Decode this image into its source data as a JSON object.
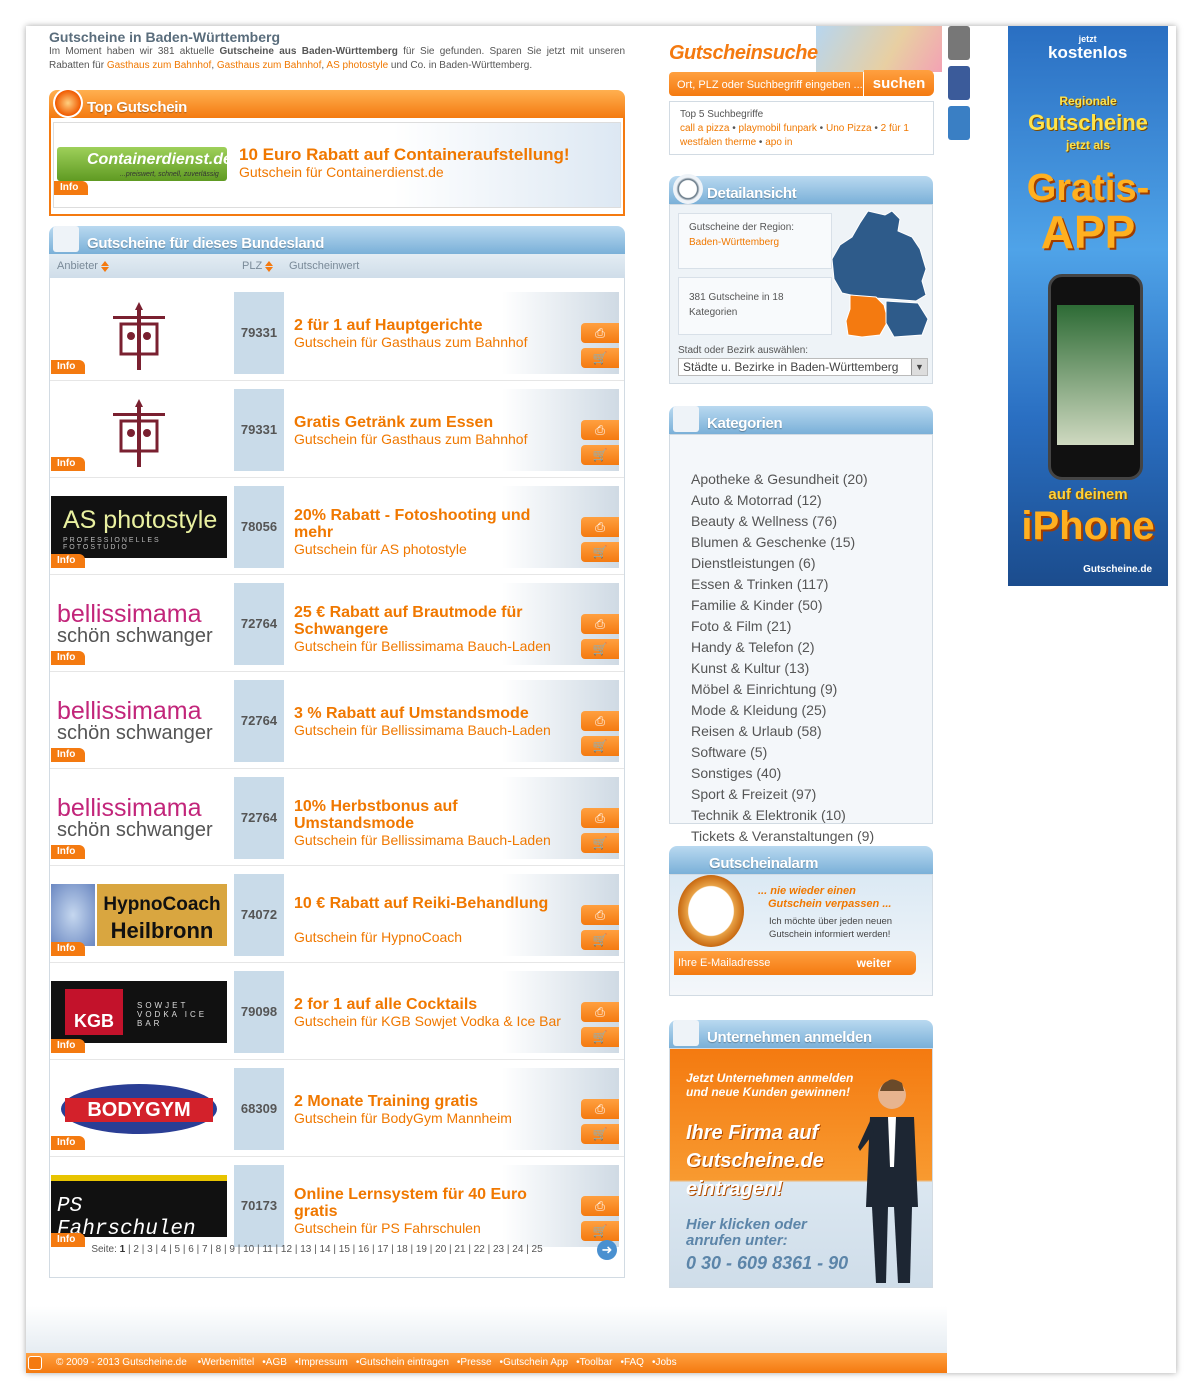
{
  "intro": {
    "title": "Gutscheine in Baden-Württemberg",
    "text_a": "Im Moment haben wir 381 aktuelle ",
    "text_b": "Gutscheine aus Baden-Württemberg",
    "text_c": " für Sie gefunden. Sparen Sie jetzt mit unseren Rabatten für ",
    "link1": "Gasthaus zum Bahnhof",
    "link2": "Gasthaus zum Bahnhof",
    "link3": "AS photostyle",
    "text_d": " und Co. in Baden-Württemberg."
  },
  "top_gutschein": {
    "header": "Top Gutschein",
    "logo_text": "Containerdienst.de",
    "logo_sub": "...preiswert, schnell, zuverlässig",
    "title": "10 Euro Rabatt auf Containeraufstellung!",
    "subtitle": "Gutschein für Containerdienst.de",
    "info": "Info"
  },
  "list": {
    "header": "Gutscheine für dieses Bundesland",
    "col_anbieter": "Anbieter",
    "col_plz": "PLZ",
    "col_wert": "Gutscheinwert",
    "info": "Info",
    "rows": [
      {
        "logo": "Gasthaus",
        "plz": "79331",
        "title": "2 für 1 auf Hauptgerichte",
        "sub": "Gutschein für Gasthaus zum Bahnhof"
      },
      {
        "logo": "Gasthaus",
        "plz": "79331",
        "title": "Gratis Getränk zum Essen",
        "sub": "Gutschein für Gasthaus zum Bahnhof"
      },
      {
        "logo": "AS photostyle",
        "logo_sub": "PROFESSIONELLES FOTOSTUDIO",
        "plz": "78056",
        "title": "20% Rabatt - Fotoshooting und mehr",
        "sub": "Gutschein für AS photostyle"
      },
      {
        "logo": "Bellissimama",
        "logo_sub": "schön schwanger",
        "plz": "72764",
        "title": "25 € Rabatt auf Brautmode für Schwangere",
        "sub": "Gutschein für Bellissimama Bauch-Laden"
      },
      {
        "logo": "Bellissimama",
        "logo_sub": "schön schwanger",
        "plz": "72764",
        "title": "3 % Rabatt auf Umstandsmode",
        "sub": "Gutschein für Bellissimama Bauch-Laden"
      },
      {
        "logo": "Bellissimama",
        "logo_sub": "schön schwanger",
        "plz": "72764",
        "title": "10% Herbstbonus auf Umstandsmode",
        "sub": "Gutschein für Bellissimama Bauch-Laden"
      },
      {
        "logo": "HypnoCoach",
        "logo_sub": "Heilbronn",
        "plz": "74072",
        "title": "10 € Rabatt auf Reiki-Behandlung",
        "sub": "Gutschein für HypnoCoach"
      },
      {
        "logo": "KGB",
        "logo_sub": "SOWJET VODKA ICE BAR",
        "plz": "79098",
        "title": "2 for 1 auf alle Cocktails",
        "sub": "Gutschein für KGB Sowjet Vodka & Ice Bar"
      },
      {
        "logo": "BODYGYM",
        "plz": "68309",
        "title": "2 Monate Training gratis",
        "sub": "Gutschein für BodyGym Mannheim"
      },
      {
        "logo": "PS Fahrschulen",
        "plz": "70173",
        "title": "Online Lernsystem für 40 Euro gratis",
        "sub": "Gutschein für PS Fahrschulen"
      }
    ],
    "pager_label": "Seite:",
    "pager_current": "1",
    "pager_pages": "| 2 | 3 | 4 | 5 | 6 | 7 | 8 | 9 | 10 | 11 | 12 | 13 | 14 | 15 | 16 | 17 | 18 | 19 | 20 | 21 | 22 | 23 | 24 | 25"
  },
  "search": {
    "title": "Gutscheinsuche",
    "placeholder": "Ort, PLZ oder Suchbegriff eingeben ...",
    "button": "suchen",
    "top5_label": "Top 5 Suchbegriffe",
    "terms": [
      "call a pizza",
      "playmobil funpark",
      "Uno Pizza",
      "2 für 1 westfalen therme",
      "apo in"
    ]
  },
  "detail": {
    "header": "Detailansicht",
    "region_label": "Gutscheine der Region:",
    "region_value": "Baden-Württemberg",
    "count_text": "381 Gutscheine in 18 Kategorien",
    "select_label": "Stadt oder Bezirk auswählen:",
    "select_value": "Städte u. Bezirke in Baden-Württemberg"
  },
  "categories": {
    "header": "Kategorien",
    "items": [
      "Apotheke & Gesundheit (20)",
      "Auto & Motorrad (12)",
      "Beauty & Wellness (76)",
      "Blumen & Geschenke (15)",
      "Dienstleistungen (6)",
      "Essen & Trinken (117)",
      "Familie & Kinder (50)",
      "Foto & Film (21)",
      "Handy & Telefon (2)",
      "Kunst & Kultur (13)",
      "Möbel & Einrichtung (9)",
      "Mode & Kleidung (25)",
      "Reisen & Urlaub (58)",
      "Software (5)",
      "Sonstiges (40)",
      "Sport & Freizeit (97)",
      "Technik & Elektronik (10)",
      "Tickets & Veranstaltungen (9)"
    ]
  },
  "alarm": {
    "header": "Gutscheinalarm",
    "tag1": "... nie wieder einen",
    "tag2": "Gutschein verpassen ...",
    "text": "Ich möchte über jeden neuen Gutschein informiert werden!",
    "placeholder": "Ihre E-Mailadresse",
    "button": "weiter"
  },
  "register": {
    "header": "Unternehmen anmelden",
    "line1": "Jetzt Unternehmen anmelden",
    "line2": "und neue Kunden gewinnen!",
    "big1": "Ihre Firma auf",
    "big2": "Gutscheine.de",
    "big3": "eintragen!",
    "call1": "Hier klicken oder",
    "call2": "anrufen unter:",
    "phone": "0 30 - 609 8361 - 90"
  },
  "ad": {
    "t1a": "jetzt",
    "t1b": "kostenlos",
    "t2a": "Regionale",
    "t2b": "Gutscheine",
    "t2c": "jetzt als",
    "t3a": "Gratis-",
    "t3b": "APP",
    "t4": "auf deinem",
    "t5": "iPhone",
    "t6": "Gutscheine.de"
  },
  "footer": {
    "copyright": "© 2009 - 2013 Gutscheine.de",
    "links": [
      "Werbemittel",
      "AGB",
      "Impressum",
      "Gutschein eintragen",
      "Presse",
      "Gutschein App",
      "Toolbar",
      "FAQ",
      "Jobs"
    ]
  },
  "colors": {
    "accent": "#f47a10",
    "blue": "#7ab0d8",
    "text": "#555555"
  }
}
